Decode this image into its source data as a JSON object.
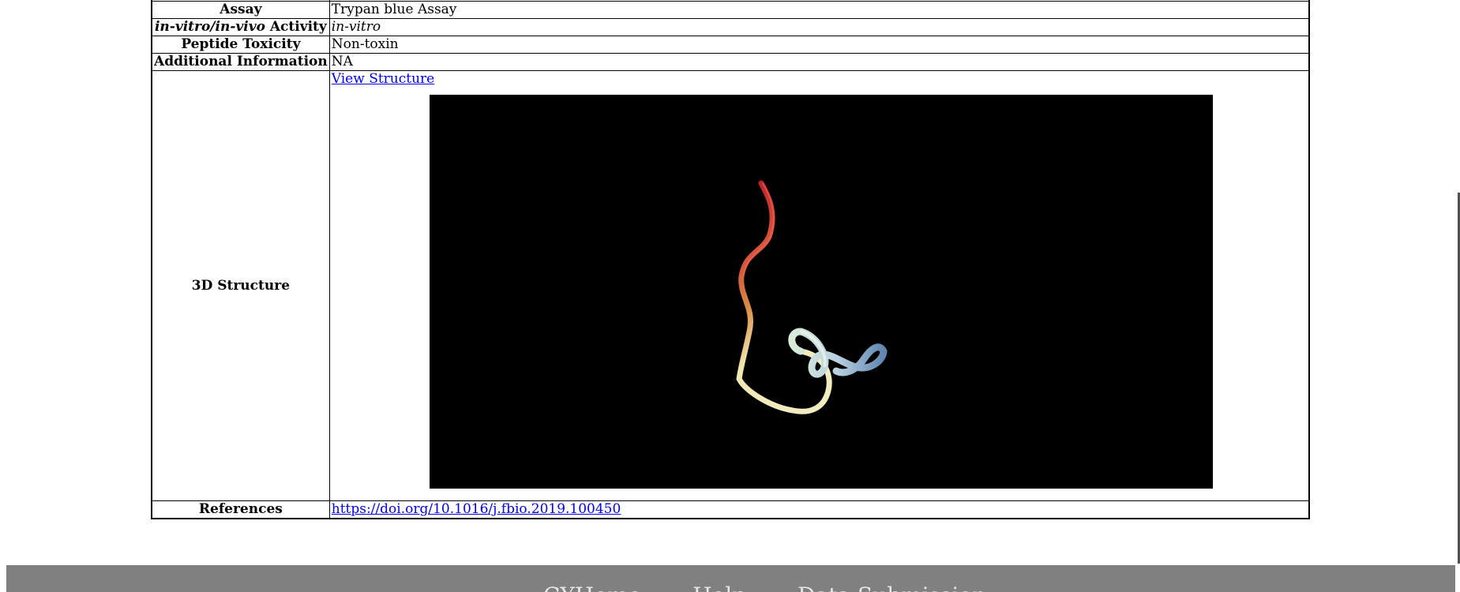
{
  "table": {
    "rows": {
      "assay": {
        "label": "Assay",
        "value": "Trypan blue Assay"
      },
      "activity": {
        "label_em": "in-vitro/in-vivo",
        "label_rest": " Activity",
        "value": "in-vitro"
      },
      "toxicity": {
        "label": "Peptide Toxicity",
        "value": "Non-toxin"
      },
      "additional": {
        "label": "Additional Information",
        "value": "NA"
      },
      "structure": {
        "label": "3D Structure",
        "link_text": "View Structure"
      },
      "references": {
        "label": "References",
        "link_text": "https://doi.org/10.1016/j.fbio.2019.100450"
      }
    }
  },
  "footer": {
    "links": [
      "CYHome",
      "Help",
      "Data Submission"
    ]
  },
  "colors": {
    "viewer_background": "#000000",
    "footer_background": "#808080",
    "link": "#0000ee",
    "ribbon_red": "#c8202a",
    "ribbon_orange": "#d98a44",
    "ribbon_cream": "#f0e6b0",
    "ribbon_pale": "#e6f2e6",
    "ribbon_blue": "#7fa6c8"
  }
}
